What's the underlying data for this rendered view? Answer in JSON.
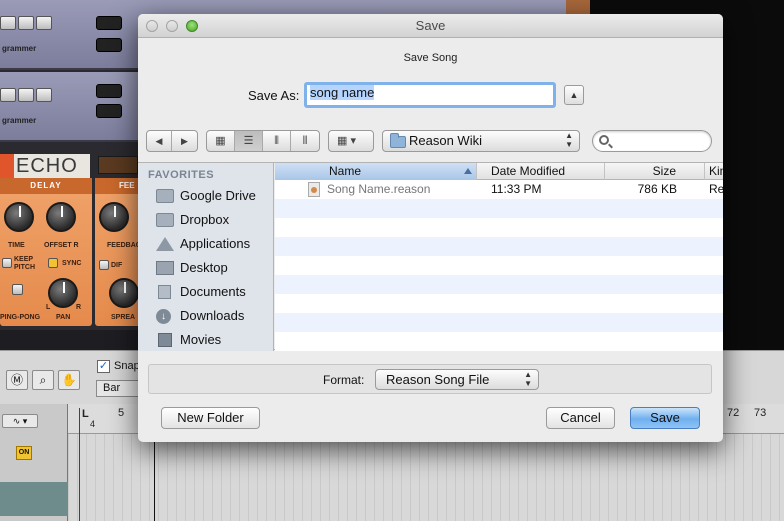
{
  "background_app": {
    "rack_labels": [
      "grammer",
      "grammer"
    ],
    "echo_title": "ECHO",
    "delay_panel": {
      "heading": "DELAY",
      "knobs": [
        "TIME",
        "OFFSET R",
        "PAN"
      ],
      "keep_pitch": "KEEP PITCH",
      "sync": "SYNC",
      "ping_pong": "PING-PONG",
      "l": "L",
      "r": "R"
    },
    "feed_panel": {
      "heading": "FEE",
      "label1": "FEEDBAC",
      "label2": "DIF",
      "label3": "SPREA"
    },
    "toolbar": {
      "snap_label": "Snap",
      "snap_checked": true,
      "grid_value": "Bar"
    },
    "ruler": [
      "4",
      "5",
      "72",
      "73"
    ],
    "loop_marker": "L",
    "on_button": "ON"
  },
  "dialog": {
    "title": "Save",
    "subtitle": "Save Song",
    "save_as_label": "Save As:",
    "save_as_value": "song name",
    "location": "Reason Wiki",
    "search_placeholder": "",
    "sidebar": {
      "heading": "FAVORITES",
      "items": [
        {
          "label": "Google Drive",
          "icon": "folder-icon"
        },
        {
          "label": "Dropbox",
          "icon": "folder-icon"
        },
        {
          "label": "Applications",
          "icon": "applications-icon"
        },
        {
          "label": "Desktop",
          "icon": "desktop-icon"
        },
        {
          "label": "Documents",
          "icon": "documents-icon"
        },
        {
          "label": "Downloads",
          "icon": "downloads-icon"
        },
        {
          "label": "Movies",
          "icon": "movies-icon"
        }
      ]
    },
    "columns": {
      "name": "Name",
      "date": "Date Modified",
      "size": "Size",
      "kind": "Kin"
    },
    "files": [
      {
        "name": "Song Name.reason",
        "date": "11:33 PM",
        "size": "786 KB",
        "kind": "Re"
      }
    ],
    "format_label": "Format:",
    "format_value": "Reason Song File",
    "new_folder_label": "New Folder",
    "cancel_label": "Cancel",
    "save_label": "Save"
  },
  "colors": {
    "accent": "#6fb0ef",
    "selection": "#b5d5ff",
    "sidebar_bg": "#dfe4ea"
  }
}
